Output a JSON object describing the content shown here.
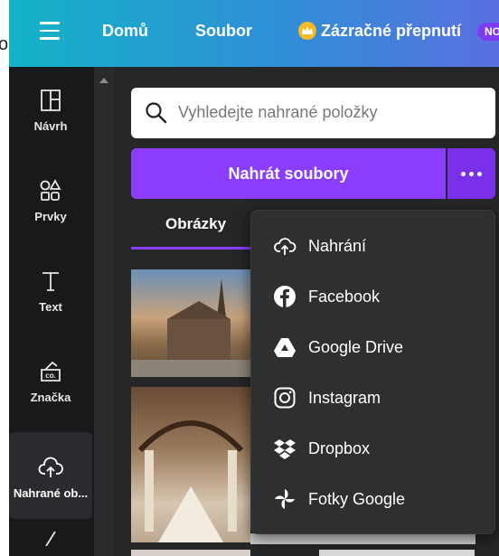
{
  "topbar": {
    "home": "Domů",
    "file": "Soubor",
    "magic_switch": "Zázračné přepnutí",
    "badge": "NO",
    "edge_fragment": "o"
  },
  "sidebar": {
    "items": [
      {
        "label": "Návrh",
        "icon": "layout-icon"
      },
      {
        "label": "Prvky",
        "icon": "shapes-icon"
      },
      {
        "label": "Text",
        "icon": "text-icon"
      },
      {
        "label": "Značka",
        "icon": "brand-icon"
      },
      {
        "label": "Nahrané ob...",
        "icon": "cloud-upload-icon",
        "active": true
      }
    ]
  },
  "search": {
    "placeholder": "Vyhledejte nahrané položky"
  },
  "upload_button": {
    "label": "Nahrát soubory"
  },
  "tabs": [
    {
      "label": "Obrázky",
      "selected": true
    }
  ],
  "dropdown": {
    "items": [
      {
        "label": "Nahrání",
        "icon": "cloud-upload-icon"
      },
      {
        "label": "Facebook",
        "icon": "facebook-icon"
      },
      {
        "label": "Google Drive",
        "icon": "google-drive-icon"
      },
      {
        "label": "Instagram",
        "icon": "instagram-icon"
      },
      {
        "label": "Dropbox",
        "icon": "dropbox-icon"
      },
      {
        "label": "Fotky Google",
        "icon": "google-photos-icon"
      }
    ]
  },
  "colors": {
    "accent": "#8b3dff",
    "sidebar_bg": "#18191b",
    "panel_bg": "#252627",
    "dropdown_bg": "#2e2f31"
  }
}
